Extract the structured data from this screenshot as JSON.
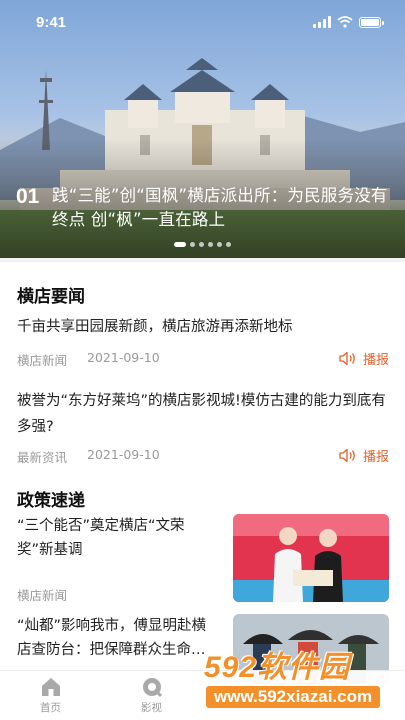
{
  "status_bar": {
    "time": "9:41"
  },
  "hero": {
    "index": "01",
    "title": "践“三能”创“国枫”横店派出所：为民服务没有终点 创“枫”一直在路上",
    "slide_count": 6,
    "active_slide": 1
  },
  "sections": {
    "news": {
      "title": "横店要闻",
      "items": [
        {
          "title": "千亩共享田园展新颜，横店旅游再添新地标",
          "source": "横店新闻",
          "date": "2021-09-10",
          "action": "播报"
        },
        {
          "title": "被誉为“东方好莱坞”的横店影视城!模仿古建的能力到底有多强?",
          "source": "最新资讯",
          "date": "2021-09-10",
          "action": "播报"
        }
      ]
    },
    "policy": {
      "title": "政策速递",
      "items": [
        {
          "title": "“三个能否”奠定横店“文荣奖”新基调",
          "source": "横店新闻"
        },
        {
          "title": "“灿都”影响我市，傅显明赴横店查防台：把保障群众生命…",
          "source": ""
        }
      ]
    }
  },
  "tabbar": {
    "items": [
      {
        "label": "首页",
        "icon": "home-icon"
      },
      {
        "label": "影视",
        "icon": "film-icon"
      }
    ]
  },
  "watermark": {
    "main": "592软件园",
    "sub": "www.592xiazai.com"
  },
  "colors": {
    "accent": "#e8612c",
    "meta": "#9a9a9a",
    "watermark": "#f4902a"
  }
}
